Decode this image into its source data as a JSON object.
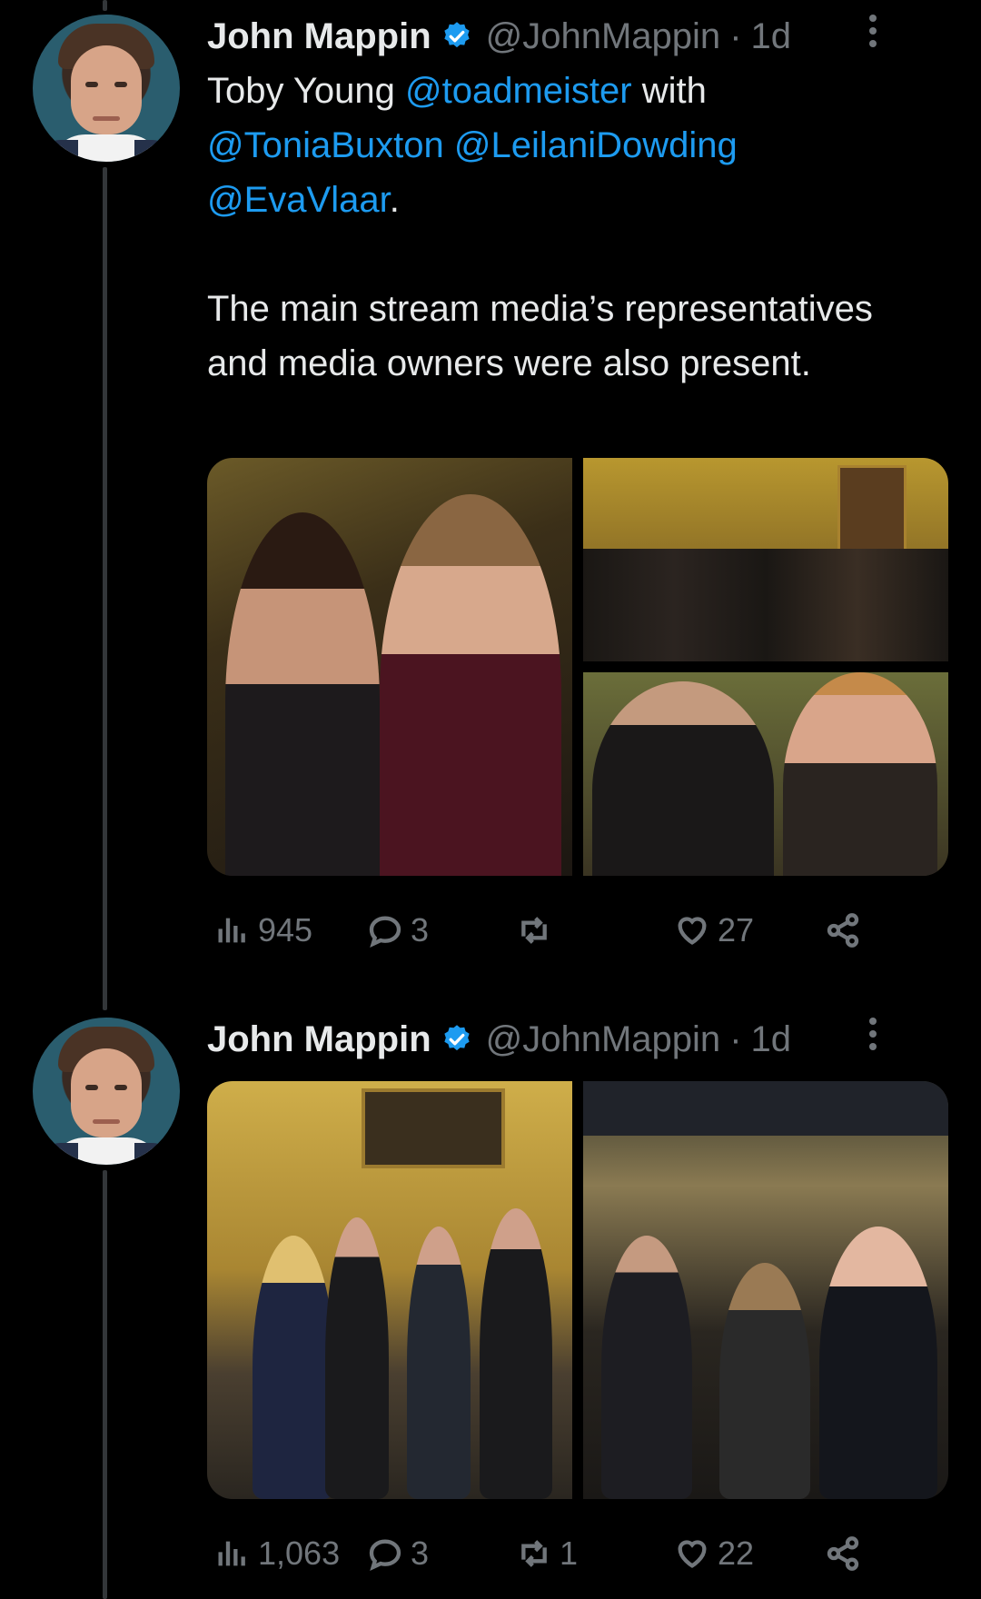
{
  "tweets": [
    {
      "author": {
        "name": "John Mappin",
        "handle": "@JohnMappin",
        "time": "1d"
      },
      "text": {
        "line1_prefix": "Toby Young ",
        "mention1": "@toadmeister",
        "line1_suffix": " with",
        "mention2": "@ToniaBuxton",
        "mention3": "@LeilaniDowding",
        "mention4": "@EvaVlaar",
        "period": ".",
        "para2": "The main stream media’s representatives and media owners were also present."
      },
      "stats": {
        "views": "945",
        "replies": "3",
        "retweets": "",
        "likes": "27"
      }
    },
    {
      "author": {
        "name": "John Mappin",
        "handle": "@JohnMappin",
        "time": "1d"
      },
      "stats": {
        "views": "1,063",
        "replies": "3",
        "retweets": "1",
        "likes": "22"
      }
    }
  ],
  "icons": {
    "verified": "verified-badge-icon",
    "more": "more-options-icon",
    "views": "analytics-icon",
    "reply": "reply-icon",
    "retweet": "retweet-icon",
    "like": "heart-icon",
    "share": "share-icon"
  },
  "colors": {
    "background": "#000000",
    "text": "#e7e9ea",
    "muted": "#71767b",
    "link": "#1d9bf0"
  },
  "dot": "·"
}
